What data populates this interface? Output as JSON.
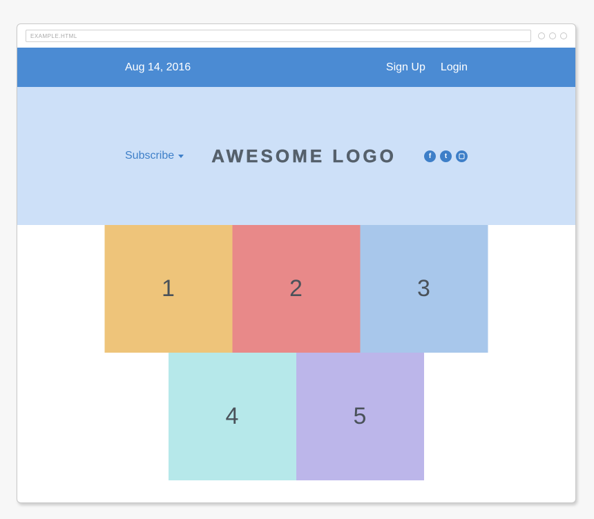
{
  "browser": {
    "url_label": "EXAMPLE.HTML"
  },
  "topnav": {
    "date": "Aug 14, 2016",
    "signup": "Sign Up",
    "login": "Login"
  },
  "hero": {
    "subscribe_label": "Subscribe",
    "logo_text": "AWESOME LOGO",
    "social": {
      "facebook_glyph": "f",
      "twitter_glyph": "t",
      "instagram_glyph": "▢"
    }
  },
  "tiles": {
    "t1": "1",
    "t2": "2",
    "t3": "3",
    "t4": "4",
    "t5": "5"
  }
}
